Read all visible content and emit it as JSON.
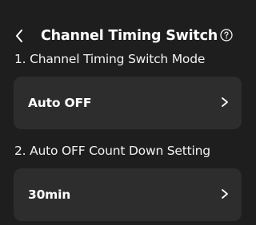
{
  "header": {
    "back_icon": "chevron-left-icon",
    "title": "Channel Timing Switch",
    "help_icon": "question-circle-icon"
  },
  "sections": [
    {
      "label": "1. Channel Timing Switch Mode",
      "value": "Auto OFF",
      "icon": "chevron-right-icon"
    },
    {
      "label": "2. Auto OFF Count Down Setting",
      "value": "30min",
      "icon": "chevron-right-icon"
    }
  ],
  "colors": {
    "background": "#1e1e1e",
    "card": "#2d2d2d",
    "text": "#ffffff"
  }
}
